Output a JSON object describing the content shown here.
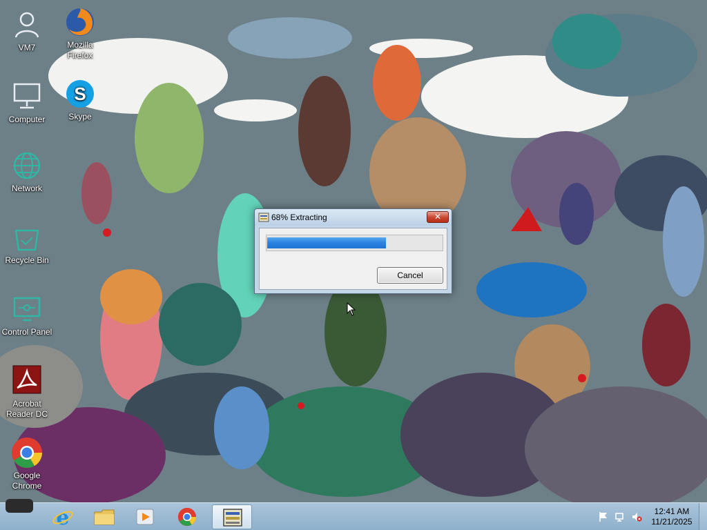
{
  "desktop": {
    "icons": [
      {
        "label": "VM7",
        "icon": "user-icon"
      },
      {
        "label": "Mozilla Firefox",
        "icon": "firefox-icon"
      },
      {
        "label": "Computer",
        "icon": "computer-icon"
      },
      {
        "label": "Skype",
        "icon": "skype-icon"
      },
      {
        "label": "Network",
        "icon": "network-icon"
      },
      {
        "label": "Recycle Bin",
        "icon": "recycle-bin-icon"
      },
      {
        "label": "Control Panel",
        "icon": "control-panel-icon"
      },
      {
        "label": "Acrobat Reader DC",
        "icon": "acrobat-icon"
      },
      {
        "label": "Google Chrome",
        "icon": "chrome-icon"
      }
    ]
  },
  "dialog": {
    "title": "68% Extracting",
    "progress": 0.68,
    "close_label": "✕",
    "cancel_label": "Cancel"
  },
  "taskbar": {
    "pinned": [
      {
        "name": "internet-explorer",
        "icon": "ie-icon"
      },
      {
        "name": "file-explorer",
        "icon": "folder-icon"
      },
      {
        "name": "media-player",
        "icon": "media-player-icon"
      },
      {
        "name": "google-chrome",
        "icon": "chrome-icon"
      },
      {
        "name": "extractor",
        "icon": "extractor-icon"
      }
    ],
    "clock": {
      "time": "12:41 AM",
      "date": "11/21/2025"
    }
  },
  "colors": {
    "taskbar": "#9fbcd4",
    "progress_fill": "#2a82e0",
    "close_button": "#c8462f"
  }
}
